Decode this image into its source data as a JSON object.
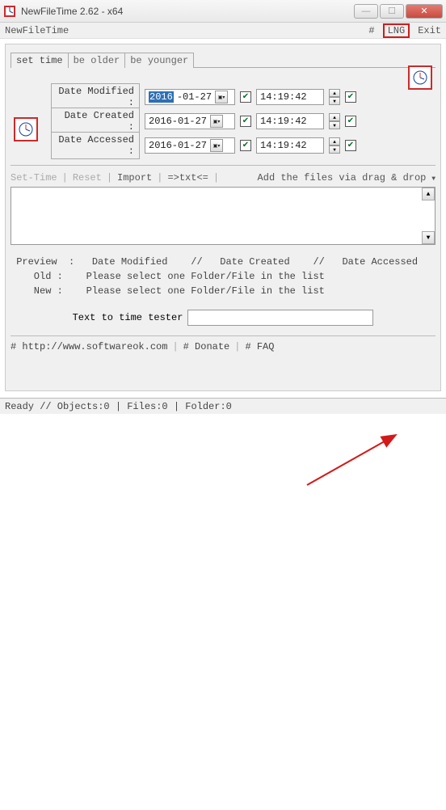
{
  "window": {
    "title": "NewFileTime 2.62 - x64"
  },
  "menubar": {
    "app_name": "NewFileTime",
    "hash": "#",
    "lng": "LNG",
    "exit": "Exit"
  },
  "tabs": {
    "set_time": "set time",
    "be_older": "be older",
    "be_younger": "be younger"
  },
  "rows": {
    "modified": {
      "label": "Date Modified :",
      "date_year_sel": "2016",
      "date_rest": "-01-27",
      "time": "14:19:42"
    },
    "created": {
      "label": "Date Created :",
      "date": "2016-01-27",
      "time": "14:19:42"
    },
    "accessed": {
      "label": "Date Accessed :",
      "date": "2016-01-27",
      "time": "14:19:42"
    }
  },
  "toolbar2": {
    "set_time": "Set-Time",
    "reset": "Reset",
    "import": "Import",
    "txt_btn": "=>txt<=",
    "drag_drop": "Add the files via drag & drop"
  },
  "preview": {
    "header": " Preview  :   Date Modified    //   Date Created    //   Date Accessed",
    "old": "    Old :    Please select one Folder/File in the list",
    "new": "    New :    Please select one Folder/File in the list"
  },
  "tester": {
    "label": "Text to time tester",
    "value": ""
  },
  "bottom": {
    "site": "# http://www.softwareok.com",
    "donate": "# Donate",
    "faq": "# FAQ"
  },
  "statusbar": {
    "text": "Ready // Objects:0 | Files:0 | Folder:0"
  }
}
